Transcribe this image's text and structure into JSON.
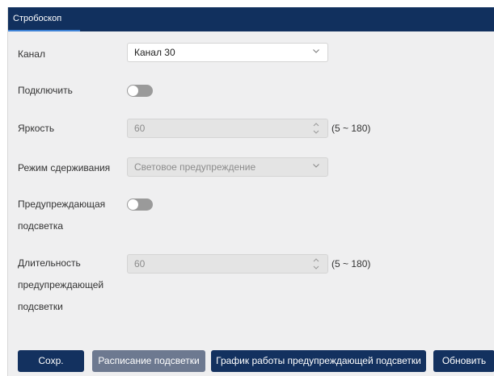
{
  "header": {
    "tab_label": "Стробоскоп"
  },
  "form": {
    "channel": {
      "label": "Канал",
      "value": "Канал 30"
    },
    "enable": {
      "label": "Подключить",
      "on": false
    },
    "brightness": {
      "label": "Яркость",
      "value": "60",
      "range": "(5 ~ 180)"
    },
    "deterrence_mode": {
      "label": "Режим сдерживания",
      "value": "Световое предупреждение"
    },
    "warning_light": {
      "label_line1": "Предупреждающая",
      "label_line2": "подсветка",
      "on": false
    },
    "duration": {
      "label_line1": "Длительность",
      "label_line2": "предупреждающей",
      "label_line3": "подсветки",
      "value": "60",
      "range": "(5 ~ 180)"
    }
  },
  "buttons": {
    "save": "Сохр.",
    "light_schedule": "Расписание подсветки",
    "warning_schedule": "График работы предупреждающей подсветки",
    "refresh": "Обновить"
  },
  "colors": {
    "header_bg": "#11305e",
    "tab_underline": "#3d82d6",
    "panel_bg": "#efeff0",
    "primary_button": "#13315f",
    "muted_button": "#6d7990",
    "toggle_off": "#9a9a9a"
  }
}
